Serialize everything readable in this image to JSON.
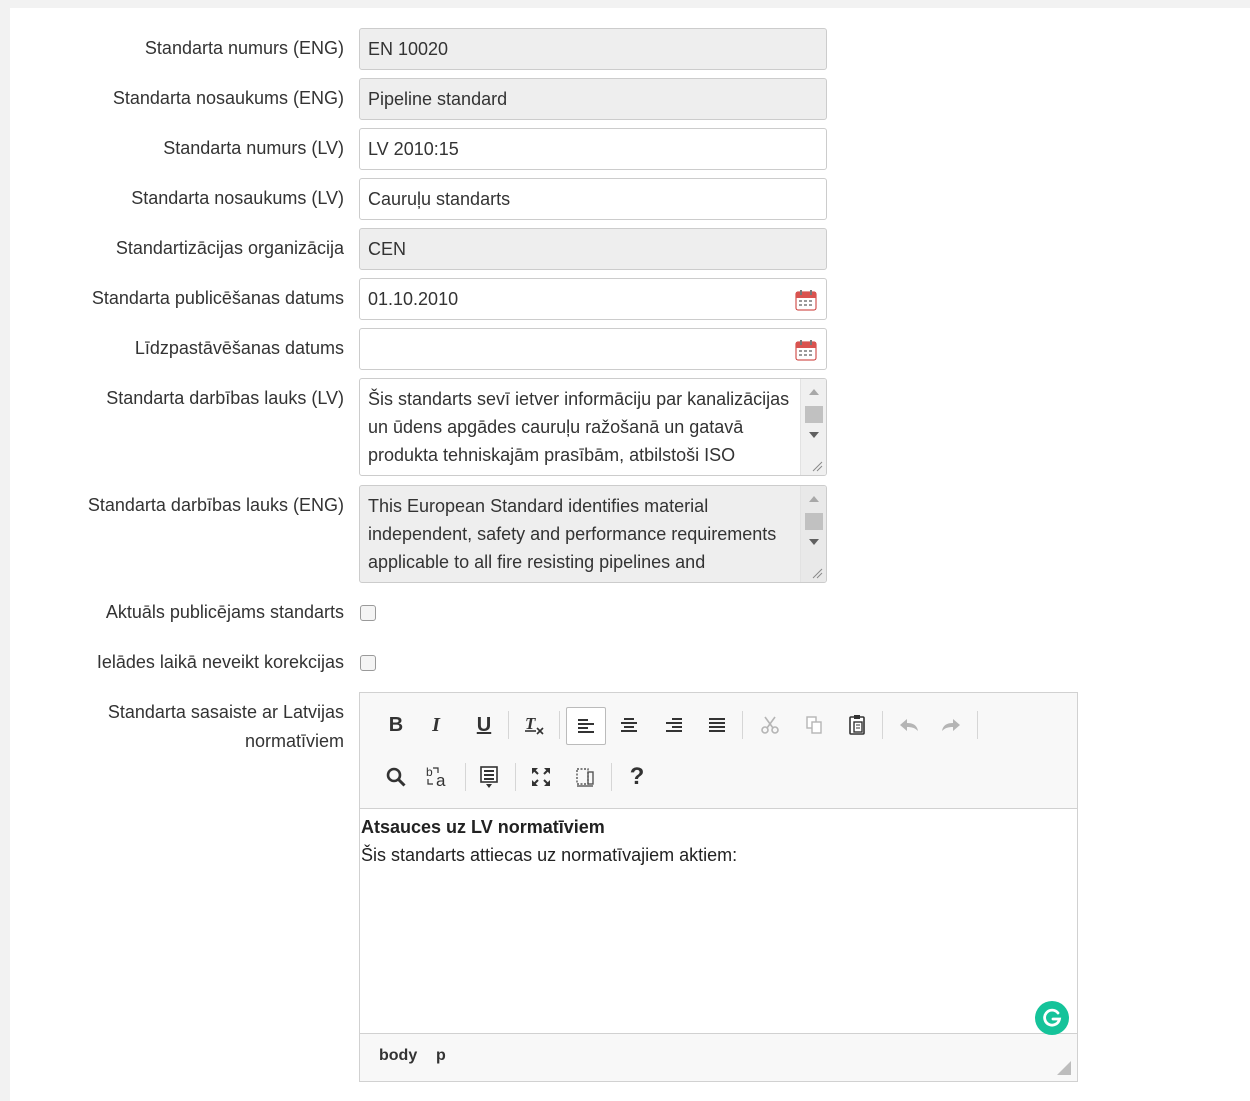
{
  "fields": [
    {
      "label": "Standarta numurs (ENG)",
      "value": "EN 10020"
    },
    {
      "label": "Standarta nosaukums (ENG)",
      "value": "Pipeline standard"
    },
    {
      "label": "Standarta numurs (LV)",
      "value": "LV 2010:15"
    },
    {
      "label": "Standarta nosaukums (LV)",
      "value": "Cauruļu standarts"
    },
    {
      "label": "Standartizācijas organizācija",
      "value": "CEN"
    },
    {
      "label": "Standarta publicēšanas datums",
      "value": "01.10.2010"
    },
    {
      "label": "Līdzpastāvēšanas datums",
      "value": ""
    }
  ],
  "textareas": [
    {
      "label": "Standarta darbības lauks (LV)",
      "value": "Šis standarts sevī ietver informāciju par kanalizācijas un ūdens apgādes cauruļu ražošanā un gatavā produkta tehniskajām prasībām, atbilstoši ISO standartiem."
    },
    {
      "label": "Standarta darbības lauks (ENG)",
      "value": "This European Standard identifies material independent, safety and performance requirements applicable to all fire resisting pipelines and associated products."
    }
  ],
  "checkboxes": [
    {
      "label": "Aktuāls publicējams standarts",
      "checked": false
    },
    {
      "label": "Ielādes laikā neveikt korekcijas",
      "checked": false
    }
  ],
  "editor": {
    "label": "Standarta sasaiste ar Latvijas normatīviem",
    "toolbar": {
      "bold": "B",
      "italic": "I",
      "underline": "U",
      "help": "?"
    },
    "heading": "Atsauces uz LV normatīviem",
    "paragraph": "Šis standarts attiecas uz normatīvajiem aktiem:",
    "path": [
      "body",
      "p"
    ]
  },
  "colors": {
    "readonly_bg": "#eeeeee",
    "border": "#cccccc",
    "calendar_red": "#d9534f",
    "grammarly": "#15c39a"
  }
}
